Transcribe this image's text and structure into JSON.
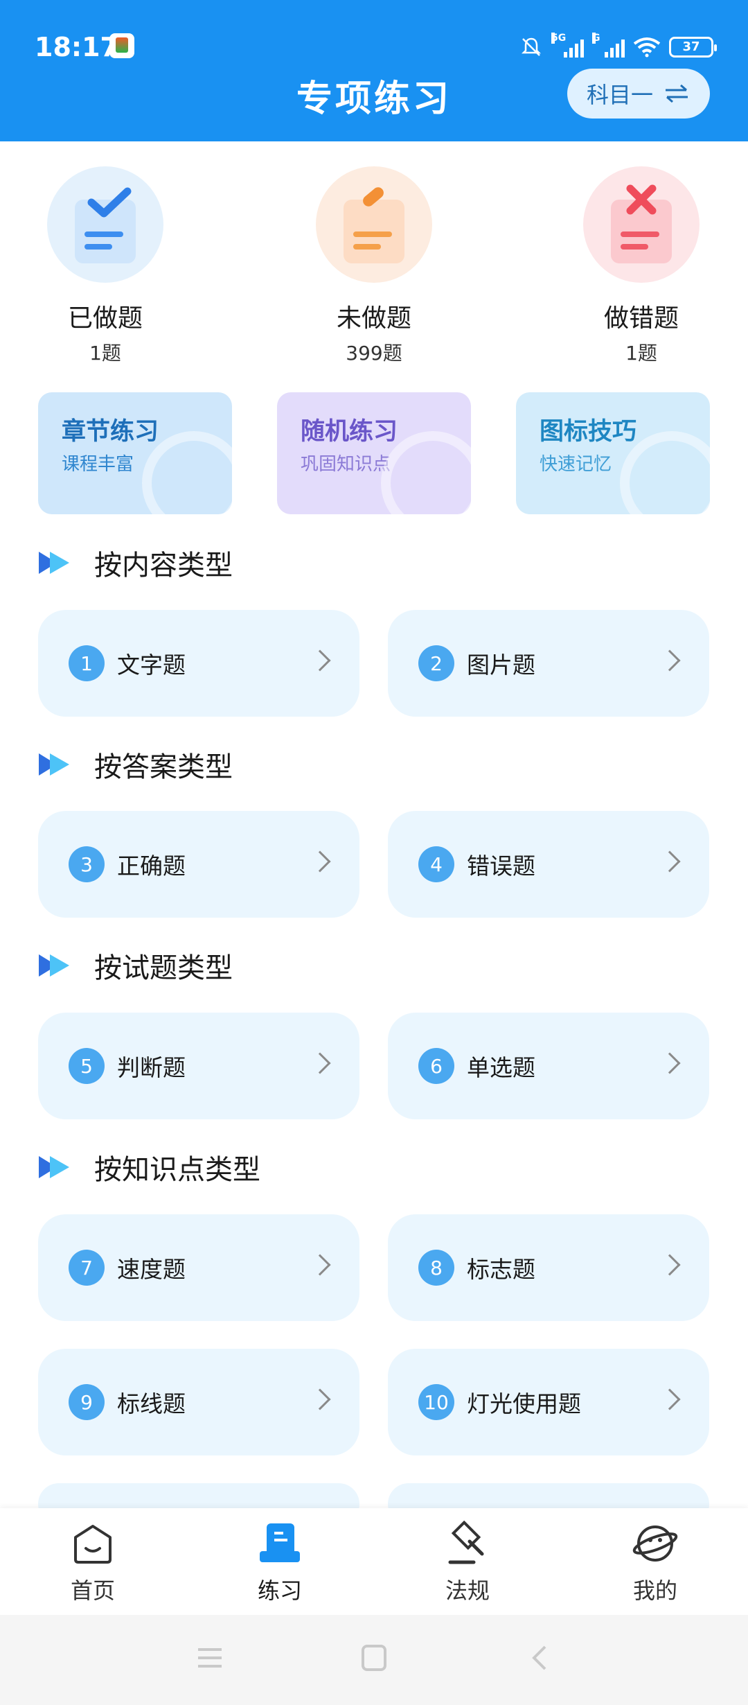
{
  "status": {
    "time": "18:17",
    "battery": "37",
    "net1": "5G",
    "net2": "G"
  },
  "header": {
    "title": "专项练习",
    "subject": "科目一"
  },
  "stats": [
    {
      "label": "已做题",
      "count": "1题",
      "color": "#3d8ef0",
      "bg": "#e4f1fc"
    },
    {
      "label": "未做题",
      "count": "399题",
      "color": "#f5a04a",
      "bg": "#fdece0"
    },
    {
      "label": "做错题",
      "count": "1题",
      "color": "#f05a68",
      "bg": "#fde6e8"
    }
  ],
  "features": [
    {
      "title": "章节练习",
      "sub": "课程丰富",
      "bg": "#cfe7fb",
      "color": "#1e6fb9"
    },
    {
      "title": "随机练习",
      "sub": "巩固知识点",
      "bg": "#e3dcfb",
      "color": "#6a56c9"
    },
    {
      "title": "图标技巧",
      "sub": "快速记忆",
      "bg": "#d3ecfb",
      "color": "#1e86c2"
    }
  ],
  "sections": [
    {
      "title": "按内容类型",
      "items": [
        {
          "num": "1",
          "label": "文字题"
        },
        {
          "num": "2",
          "label": "图片题"
        }
      ]
    },
    {
      "title": "按答案类型",
      "items": [
        {
          "num": "3",
          "label": "正确题"
        },
        {
          "num": "4",
          "label": "错误题"
        }
      ]
    },
    {
      "title": "按试题类型",
      "items": [
        {
          "num": "5",
          "label": "判断题"
        },
        {
          "num": "6",
          "label": "单选题"
        }
      ]
    },
    {
      "title": "按知识点类型",
      "items": [
        {
          "num": "7",
          "label": "速度题"
        },
        {
          "num": "8",
          "label": "标志题"
        },
        {
          "num": "9",
          "label": "标线题"
        },
        {
          "num": "10",
          "label": "灯光使用题"
        }
      ]
    }
  ],
  "nav": [
    {
      "label": "首页",
      "icon": "home-icon"
    },
    {
      "label": "练习",
      "icon": "practice-icon"
    },
    {
      "label": "法规",
      "icon": "gavel-icon"
    },
    {
      "label": "我的",
      "icon": "profile-icon"
    }
  ]
}
